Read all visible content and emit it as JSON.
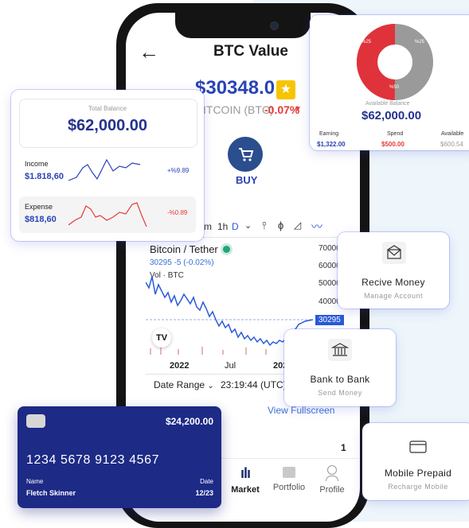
{
  "phone": {
    "title": "BTC Value",
    "price": "$30348.0",
    "ticker": "ITCOIN (BTC)",
    "change": "-0.07%",
    "buy_label": "BUY",
    "intervals": [
      "m",
      "1h",
      "D"
    ],
    "pair": "Bitcoin / Tether",
    "pair_detail": "30295 -5 (-0.02%)",
    "vol": "Vol · BTC",
    "price_axis": [
      "70000",
      "60000",
      "50000",
      "40000"
    ],
    "current_tag": "30295",
    "x_axis": [
      "2022",
      "Jul",
      "202"
    ],
    "date_range": "Date Range",
    "time": "23:19:44 (UTC)",
    "fullscreen": "View Fullscreen",
    "page_num": "1",
    "nav": [
      "Market",
      "Portfolio",
      "Profile"
    ]
  },
  "balance_card": {
    "label": "Total Balance",
    "amount": "$62,000.00",
    "income_label": "Income",
    "income_value": "$1.818,60",
    "income_pct": "+%9.89",
    "expense_label": "Expense",
    "expense_value": "$818,60",
    "expense_pct": "-%0.89"
  },
  "donut_card": {
    "legend": [
      "%25",
      "%25",
      "%50"
    ],
    "label": "Available Balance",
    "amount": "$62,000.00",
    "cols": [
      {
        "label": "Earning",
        "value": "$1,322.00"
      },
      {
        "label": "Spend",
        "value": "$500.00"
      },
      {
        "label": "Available",
        "value": "$600.54"
      }
    ]
  },
  "actions": {
    "receive": {
      "title": "Recive Money",
      "sub": "Manage Account"
    },
    "bank": {
      "title": "Bank to Bank",
      "sub": "Send Money"
    },
    "mobile": {
      "title": "Mobile Prepaid",
      "sub": "Recharge Mobile"
    }
  },
  "credit_card": {
    "amount": "$24,200.00",
    "number": "1234 5678 9123 4567",
    "name_label": "Name",
    "name": "Fletch Skinner",
    "date_label": "Date",
    "date": "12/23"
  },
  "colors": {
    "accent": "#2a43b6",
    "negative": "#e63b3b",
    "card_bg": "#1d2a86"
  }
}
